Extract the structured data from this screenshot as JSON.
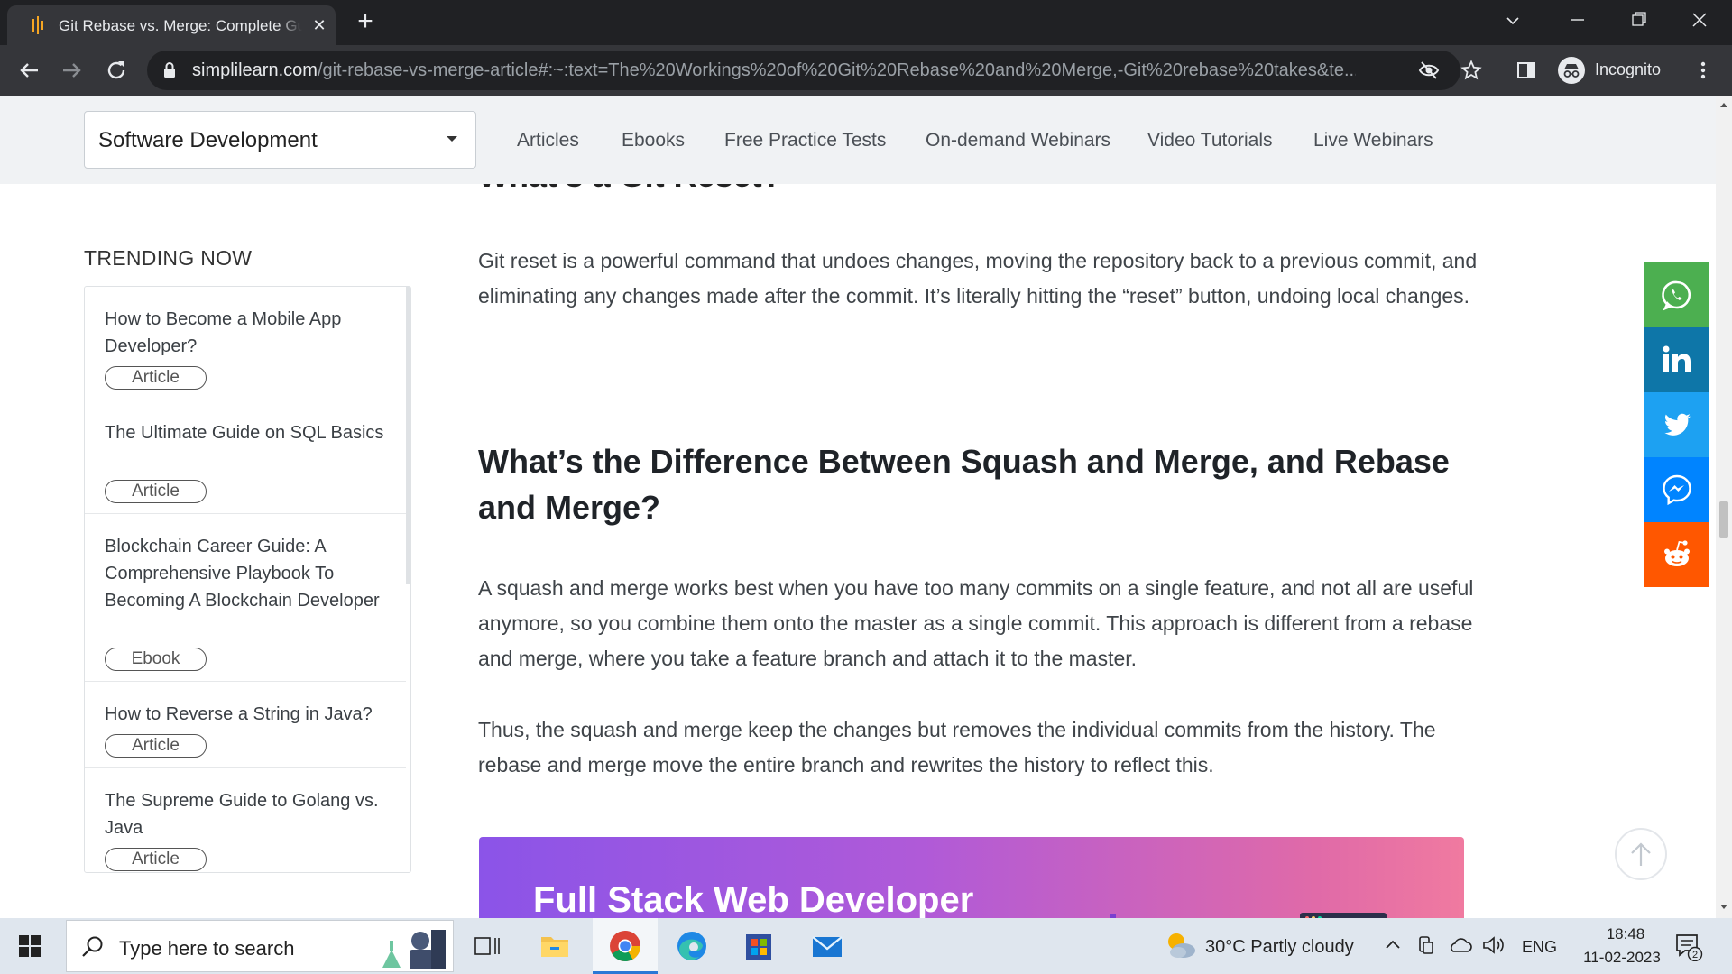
{
  "browser": {
    "tab_title": "Git Rebase vs. Merge: Complete Guide",
    "url_host": "simplilearn.com",
    "url_path": "/git-rebase-vs-merge-article#:~:text=The%20Workings%20of%20Git%20Rebase%20and%20Merge,-Git%20rebase%20takes&te...",
    "profile_label": "Incognito"
  },
  "subnav": {
    "category": "Software Development",
    "links": [
      "Articles",
      "Ebooks",
      "Free Practice Tests",
      "On-demand Webinars",
      "Video Tutorials",
      "Live Webinars"
    ]
  },
  "trending": {
    "heading": "TRENDING NOW",
    "items": [
      {
        "title": "How to Become a Mobile App Developer?",
        "badge": "Article"
      },
      {
        "title": "The Ultimate Guide on SQL Basics",
        "badge": "Article"
      },
      {
        "title": "Blockchain Career Guide: A Comprehensive Playbook To Becoming A Blockchain Developer",
        "badge": "Ebook"
      },
      {
        "title": "How to Reverse a String in Java?",
        "badge": "Article"
      },
      {
        "title": "The Supreme Guide to Golang vs. Java",
        "badge": "Article"
      }
    ]
  },
  "article": {
    "cut_heading": "What's a Git Reset?",
    "reset_paragraph": "Git reset is a powerful command that undoes changes, moving the repository back to a previous commit, and eliminating any changes made after the commit. It’s literally hitting the “reset” button, undoing local changes.",
    "heading": "What’s the Difference Between Squash and Merge, and Rebase and Merge?",
    "paragraph_1": "A squash and merge works best when you have too many commits on a single feature, and not all are useful anymore, so you combine them onto the master as a single commit. This approach is different from a rebase and merge, where you take a feature branch and attach it to the master.",
    "paragraph_2": "Thus, the squash and merge keep the changes but removes the individual commits from the history. The rebase and merge move the entire branch and rewrites the history to reflect this.",
    "promo_title": "Full Stack Web Developer"
  },
  "social": [
    {
      "icon": "whatsapp-icon",
      "color": "#4caf50"
    },
    {
      "icon": "linkedin-icon",
      "color": "#0e76a8"
    },
    {
      "icon": "twitter-icon",
      "color": "#1da1f2"
    },
    {
      "icon": "messenger-icon",
      "color": "#0084ff"
    },
    {
      "icon": "reddit-icon",
      "color": "#ff5700"
    }
  ],
  "taskbar": {
    "search_placeholder": "Type here to search",
    "weather": "30°C  Partly cloudy",
    "language": "ENG",
    "time": "18:48",
    "date": "11-02-2023",
    "notification_count": "2"
  }
}
